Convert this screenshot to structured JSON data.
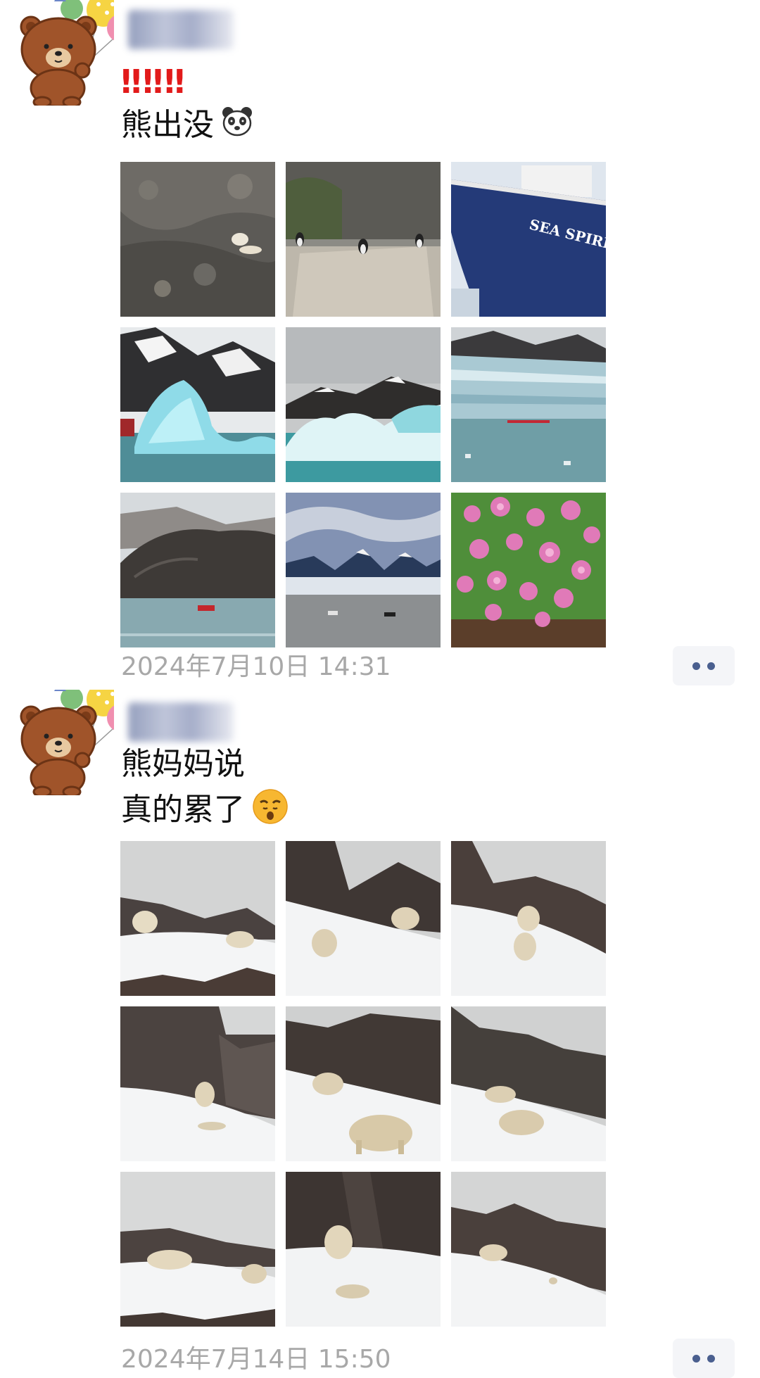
{
  "posts": [
    {
      "lines": [
        "‼️‼️‼️",
        "熊出没"
      ],
      "exclaim": "‼‼‼",
      "text_emoji": "polar-bear-face",
      "timestamp": "2024年7月10日 14:31",
      "photos": [
        "rocky-cliff-polar-bear",
        "puffins-on-rocks",
        "sea-spirit-ship-bow",
        "blue-iceberg-mountains",
        "ice-floe-cloudy-peaks",
        "glacier-front-kayaks",
        "zodiac-boat-headland",
        "snowy-peaks-bay",
        "pink-moss-campion-flowers"
      ],
      "ship_name": "SEA SPIRIT"
    },
    {
      "lines": [
        "熊妈妈说",
        "真的累了"
      ],
      "text_emoji": "sleepy-face",
      "timestamp": "2024年7月14日 15:50",
      "photos": [
        "polar-bears-snow-1",
        "polar-bears-snow-2",
        "polar-bears-snow-3",
        "polar-bears-snow-4",
        "polar-bears-snow-5",
        "polar-bears-snow-6",
        "polar-bears-snow-7",
        "polar-bears-snow-8",
        "polar-bears-snow-9"
      ]
    }
  ],
  "colors": {
    "timestamp": "#a8a8a8",
    "more_dots": "#4a5f8f",
    "exclaim": "#e21a1a"
  }
}
